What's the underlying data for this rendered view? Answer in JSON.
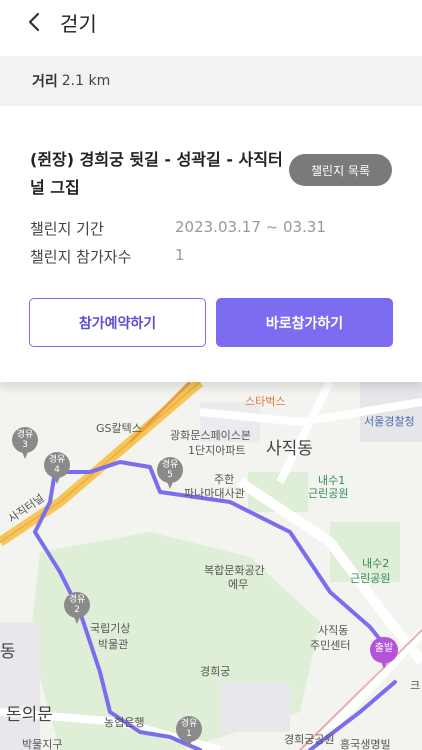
{
  "header": {
    "title": "걷기"
  },
  "distance": {
    "label": "거리",
    "value": "2.1 km"
  },
  "course": {
    "title": "(쥔장) 경희궁 뒷길 - 성곽길 - 사직터널 그집",
    "list_button": "챌린지 목록",
    "period_label": "챌린지 기간",
    "period_value": "2023.03.17 ~ 03.31",
    "participants_label": "챌린지 참가자수",
    "participants_value": "1"
  },
  "buttons": {
    "reserve": "참가예약하기",
    "join": "바로참가하기"
  },
  "map": {
    "labels": {
      "starbucks": "스타벅스",
      "police": "서울경찰청",
      "gs": "GS칼텍스",
      "apt1": "광화문스페이스본",
      "apt2": "1단지아파트",
      "sajikdong": "사직동",
      "naesu1_a": "내수1",
      "naesu1_b": "근린공원",
      "panama1": "주한",
      "panama2": "파나마대사관",
      "tunnel": "사직터널",
      "complex1": "복합문화공간",
      "complex2": "에무",
      "naesu2_a": "내수2",
      "naesu2_b": "근린공원",
      "weather1": "국립기상",
      "weather2": "박물관",
      "community1": "사직동",
      "community2": "주민센터",
      "palace": "경희궁",
      "dondong": "동",
      "donuimun": "돈의문",
      "bank": "농협은행",
      "park": "경희궁공원",
      "ku": "흥국생명빌",
      "bottom_left": "박물지구",
      "right_edge": "크"
    },
    "waypoints": {
      "wp1": [
        "경유",
        "1"
      ],
      "wp2": [
        "경유",
        "2"
      ],
      "wp3": [
        "경유",
        "3"
      ],
      "wp4": [
        "경유",
        "4"
      ],
      "wp5": [
        "경유",
        "5"
      ]
    },
    "start": "출발",
    "colors": {
      "route": "#7a6df0",
      "start_pin": "#b355d6",
      "waypoint_pin": "#8a8a8a",
      "accent": "#7b6cf0"
    }
  }
}
